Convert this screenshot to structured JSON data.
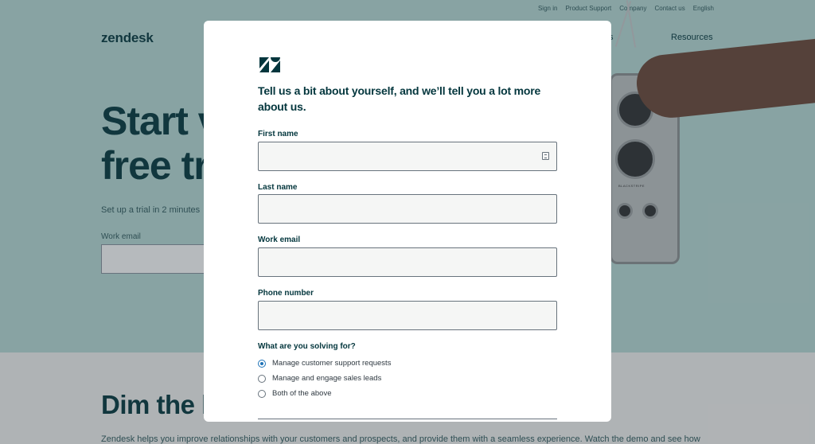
{
  "background_page": {
    "utility_nav": [
      "Sign in",
      "Product Support",
      "Company",
      "Contact us",
      "English"
    ],
    "logo": "zendesk",
    "nav_partial": "s",
    "nav_resources": "Resources",
    "hero_title_line1": "Start v",
    "hero_title_line2": "free tr",
    "hero_subtitle": "Set up a trial in 2 minutes",
    "work_email_label": "Work email",
    "section_title": "Dim the l",
    "section_body": "Zendesk helps you improve relationships with your customers and prospects, and provide them with a seamless experience. Watch the demo and see how",
    "radio_brand": "BLACKSTRIPE"
  },
  "modal": {
    "heading": "Tell us a bit about yourself, and we’ll tell you a lot more about us.",
    "fields": {
      "first_name_label": "First name",
      "first_name_value": "",
      "last_name_label": "Last name",
      "last_name_value": "",
      "work_email_label": "Work email",
      "work_email_value": "",
      "phone_label": "Phone number",
      "phone_value": ""
    },
    "solving_label": "What are you solving for?",
    "options": [
      {
        "label": "Manage customer support requests",
        "checked": true
      },
      {
        "label": "Manage and engage sales leads",
        "checked": false
      },
      {
        "label": "Both of the above",
        "checked": false
      }
    ]
  },
  "colors": {
    "brand": "#03363d",
    "hero_bg": "#b9dcd8",
    "radio_accent": "#1f73b7"
  }
}
